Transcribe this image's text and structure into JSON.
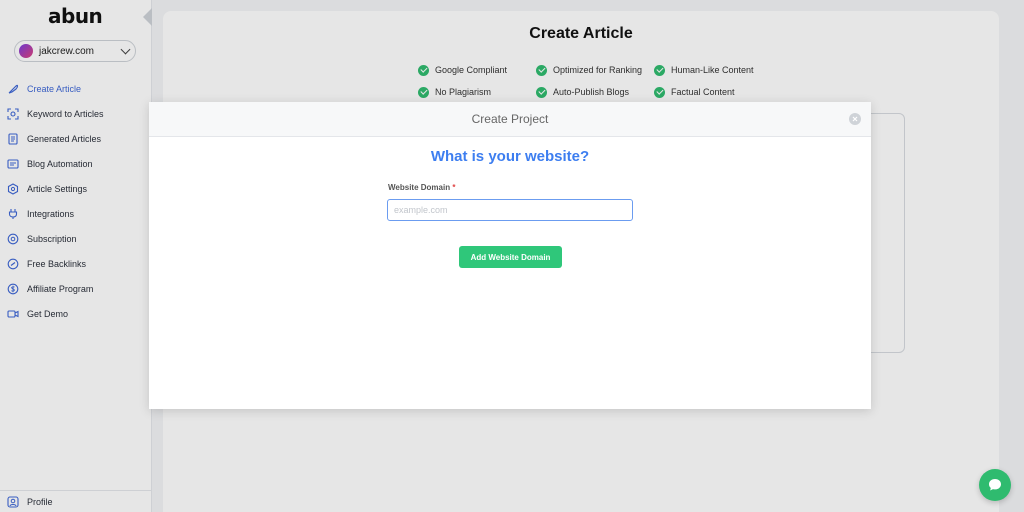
{
  "app": {
    "logo": "abun",
    "site_selector": {
      "selected": "jakcrew.com"
    }
  },
  "sidebar": {
    "items": [
      {
        "label": "Create Article",
        "icon": "feather-icon",
        "active": true
      },
      {
        "label": "Keyword to Articles",
        "icon": "keyword-scan-icon"
      },
      {
        "label": "Generated Articles",
        "icon": "document-icon"
      },
      {
        "label": "Blog Automation",
        "icon": "automation-icon"
      },
      {
        "label": "Article Settings",
        "icon": "settings-shield-icon"
      },
      {
        "label": "Integrations",
        "icon": "plug-icon"
      },
      {
        "label": "Subscription",
        "icon": "subscription-icon"
      },
      {
        "label": "Free Backlinks",
        "icon": "link-icon"
      },
      {
        "label": "Affiliate Program",
        "icon": "dollar-icon"
      },
      {
        "label": "Get Demo",
        "icon": "video-icon"
      }
    ],
    "profile_label": "Profile"
  },
  "main": {
    "title": "Create Article",
    "features": [
      "Google Compliant",
      "Optimized for Ranking",
      "Human-Like Content",
      "No Plagiarism",
      "Auto-Publish Blogs",
      "Factual Content"
    ]
  },
  "modal": {
    "title": "Create Project",
    "question": "What is your website?",
    "field_label": "Website Domain",
    "required_mark": "*",
    "input_value": "",
    "input_placeholder": "example.com",
    "submit_label": "Add Website Domain"
  },
  "colors": {
    "accent_blue": "#3d7ef0",
    "success_green": "#2fc77a",
    "active_nav": "#3e67d6"
  }
}
